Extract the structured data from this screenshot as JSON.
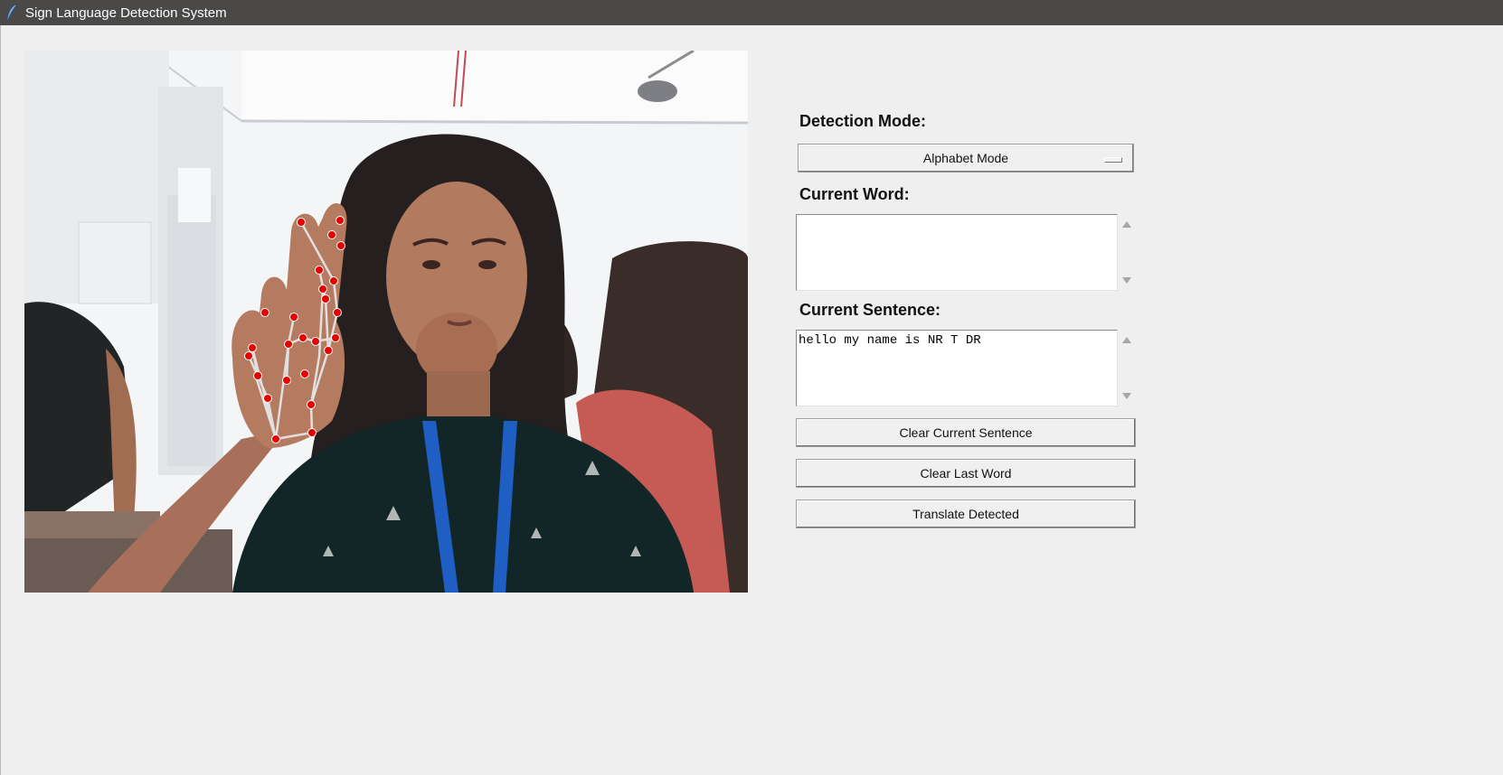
{
  "window": {
    "title": "Sign Language Detection System",
    "icon": "feather-icon"
  },
  "camera": {
    "description_icon": "webcam-feed",
    "landmark_color": "#e60000",
    "connection_color": "#e0e0e0"
  },
  "controls": {
    "detection_mode_label": "Detection Mode:",
    "detection_mode_value": "Alphabet Mode",
    "current_word_label": "Current Word:",
    "current_word_value": "",
    "current_sentence_label": "Current Sentence:",
    "current_sentence_value": "hello my name is NR T DR",
    "clear_sentence_label": "Clear Current Sentence",
    "clear_last_word_label": "Clear Last Word",
    "translate_label": "Translate Detected"
  }
}
